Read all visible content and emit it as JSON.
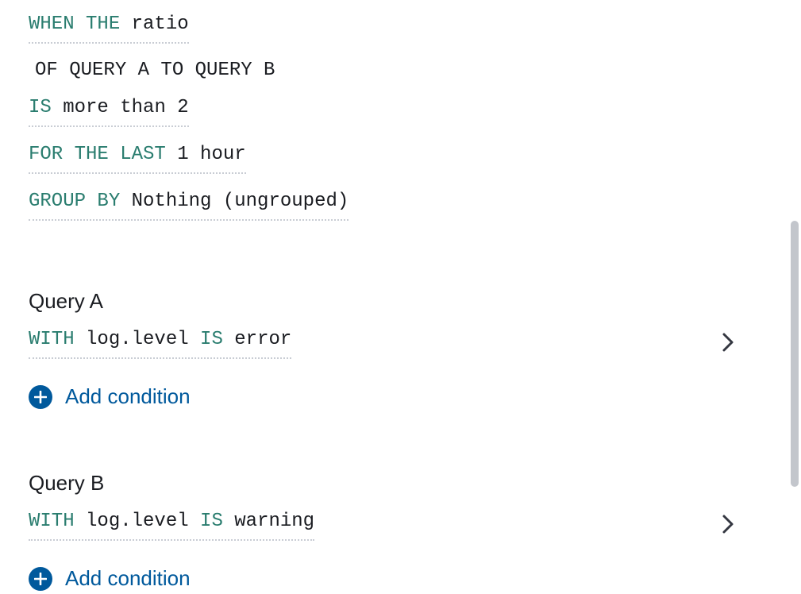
{
  "rule": {
    "when_kw": "WHEN THE",
    "when_value": "ratio",
    "of_line": "OF QUERY A TO QUERY B",
    "is_kw": "IS",
    "is_value": "more than 2",
    "for_kw": "FOR THE LAST",
    "for_value": "1 hour",
    "group_kw": "GROUP BY",
    "group_value": "Nothing (ungrouped)"
  },
  "queryA": {
    "title": "Query A",
    "with_kw": "WITH",
    "field": "log.level",
    "is_kw": "IS",
    "value": "error",
    "add_label": "Add condition"
  },
  "queryB": {
    "title": "Query B",
    "with_kw": "WITH",
    "field": "log.level",
    "is_kw": "IS",
    "value": "warning",
    "add_label": "Add condition"
  }
}
